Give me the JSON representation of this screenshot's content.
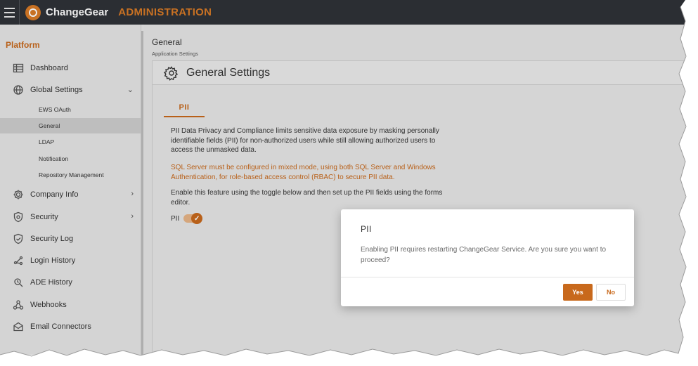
{
  "topbar": {
    "brand": "ChangeGear",
    "section": "ADMINISTRATION",
    "menu_icon": "hamburger-icon",
    "logo_icon": "changegear-logo-icon"
  },
  "sidebar": {
    "header": "Platform",
    "items": [
      {
        "label": "Dashboard",
        "icon": "table-icon"
      },
      {
        "label": "Global Settings",
        "icon": "globe-gear-icon",
        "arrow": "⌄"
      },
      {
        "label": "Company Info",
        "icon": "gear-icon",
        "arrow": "›"
      },
      {
        "label": "Security",
        "icon": "shield-gear-icon",
        "arrow": "›"
      },
      {
        "label": "Security Log",
        "icon": "shield-check-icon"
      },
      {
        "label": "Login History",
        "icon": "login-history-icon"
      },
      {
        "label": "ADE History",
        "icon": "ade-history-icon"
      },
      {
        "label": "Webhooks",
        "icon": "webhook-icon"
      },
      {
        "label": "Email Connectors",
        "icon": "email-icon"
      }
    ],
    "subitems": [
      "EWS OAuth",
      "General",
      "LDAP",
      "Notification",
      "Repository Management"
    ],
    "active_subitem": "General"
  },
  "content": {
    "title": "General",
    "subtitle": "Application Settings",
    "panel_title": "General Settings",
    "tab": "PII",
    "paragraph1": "PII Data Privacy and Compliance limits sensitive data exposure by masking personally identifiable fields (PII) for non-authorized users while still allowing authorized users to access the unmasked data.",
    "paragraph2": "SQL Server must be configured in mixed mode, using both SQL Server and Windows Authentication, for role-based access control (RBAC) to secure PII data.",
    "paragraph3": "Enable this feature using the toggle below and then set up the PII fields using the forms editor.",
    "toggle_label": "PII",
    "toggle_on": true
  },
  "modal": {
    "title": "PII",
    "message": "Enabling PII requires restarting ChangeGear Service. Are you sure you want to proceed?",
    "yes": "Yes",
    "no": "No"
  },
  "colors": {
    "accent": "#c8691c",
    "topbar": "#2f3238",
    "warning_text": "#c8691c"
  }
}
